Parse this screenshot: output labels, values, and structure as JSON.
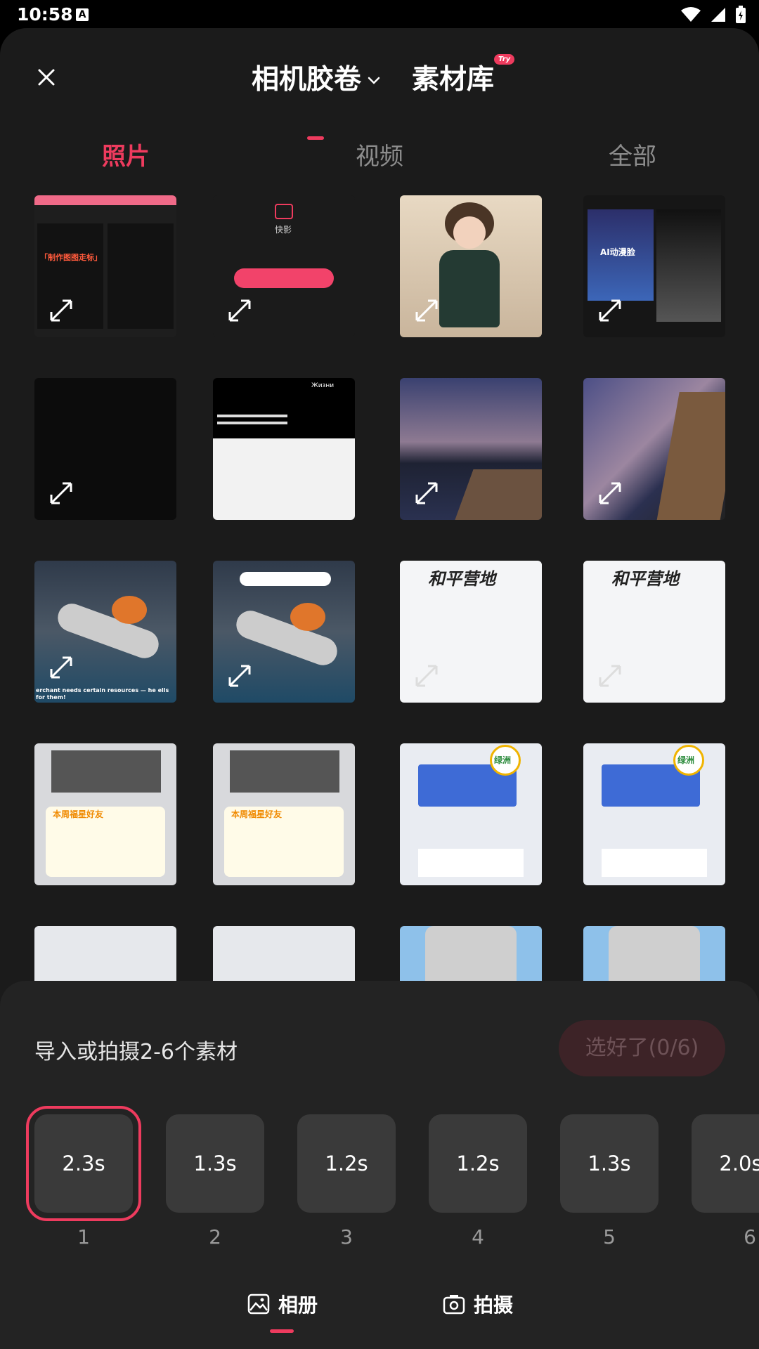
{
  "status_bar": {
    "time": "10:58",
    "notif_icon": "A"
  },
  "header": {
    "title": "相机胶卷",
    "second_title": "素材库",
    "badge": "Try"
  },
  "media_tabs": [
    {
      "label": "照片",
      "active": true
    },
    {
      "label": "视频",
      "active": false
    },
    {
      "label": "全部",
      "active": false
    }
  ],
  "thumbnails": [
    {
      "name": "thumb-app-screen-1",
      "caption": "「制作图图走标」"
    },
    {
      "name": "thumb-app-screen-2",
      "caption": "快影"
    },
    {
      "name": "thumb-girl-photo",
      "caption": ""
    },
    {
      "name": "thumb-anime-screen",
      "caption": "AI动漫脸"
    },
    {
      "name": "thumb-dark-screen",
      "caption": ""
    },
    {
      "name": "thumb-russian-menu",
      "caption": "Жизни"
    },
    {
      "name": "thumb-ocean-1",
      "caption": ""
    },
    {
      "name": "thumb-ocean-2",
      "caption": ""
    },
    {
      "name": "thumb-plane-storm-1",
      "caption": "erchant needs certain resources — he ells for them!"
    },
    {
      "name": "thumb-plane-storm-2",
      "caption": ""
    },
    {
      "name": "thumb-camps-of-peace-1",
      "caption": "和平营地"
    },
    {
      "name": "thumb-camps-of-peace-2",
      "caption": "和平营地"
    },
    {
      "name": "thumb-contacts-1",
      "caption": "本周福星好友"
    },
    {
      "name": "thumb-contacts-2",
      "caption": "本周福星好友"
    },
    {
      "name": "thumb-oasis-1",
      "caption": "绿洲"
    },
    {
      "name": "thumb-oasis-2",
      "caption": "绿洲"
    },
    {
      "name": "thumb-partial-1",
      "caption": ""
    },
    {
      "name": "thumb-partial-2",
      "caption": ""
    },
    {
      "name": "thumb-partial-3",
      "caption": ""
    },
    {
      "name": "thumb-partial-4",
      "caption": ""
    }
  ],
  "panel": {
    "hint": "导入或拍摄2-6个素材",
    "done_button": "选好了(0/6)",
    "slots": [
      {
        "duration": "2.3s",
        "index": "1",
        "selected": true
      },
      {
        "duration": "1.3s",
        "index": "2",
        "selected": false
      },
      {
        "duration": "1.2s",
        "index": "3",
        "selected": false
      },
      {
        "duration": "1.2s",
        "index": "4",
        "selected": false
      },
      {
        "duration": "1.3s",
        "index": "5",
        "selected": false
      },
      {
        "duration": "2.0s",
        "index": "6",
        "selected": false
      }
    ]
  },
  "bottom_tabs": [
    {
      "label": "相册",
      "icon": "image-icon",
      "active": true
    },
    {
      "label": "拍摄",
      "icon": "camera-icon",
      "active": false
    }
  ],
  "colors": {
    "accent": "#ee3b5e",
    "sheet_bg": "#1b1b1b",
    "panel_bg": "#232323"
  }
}
